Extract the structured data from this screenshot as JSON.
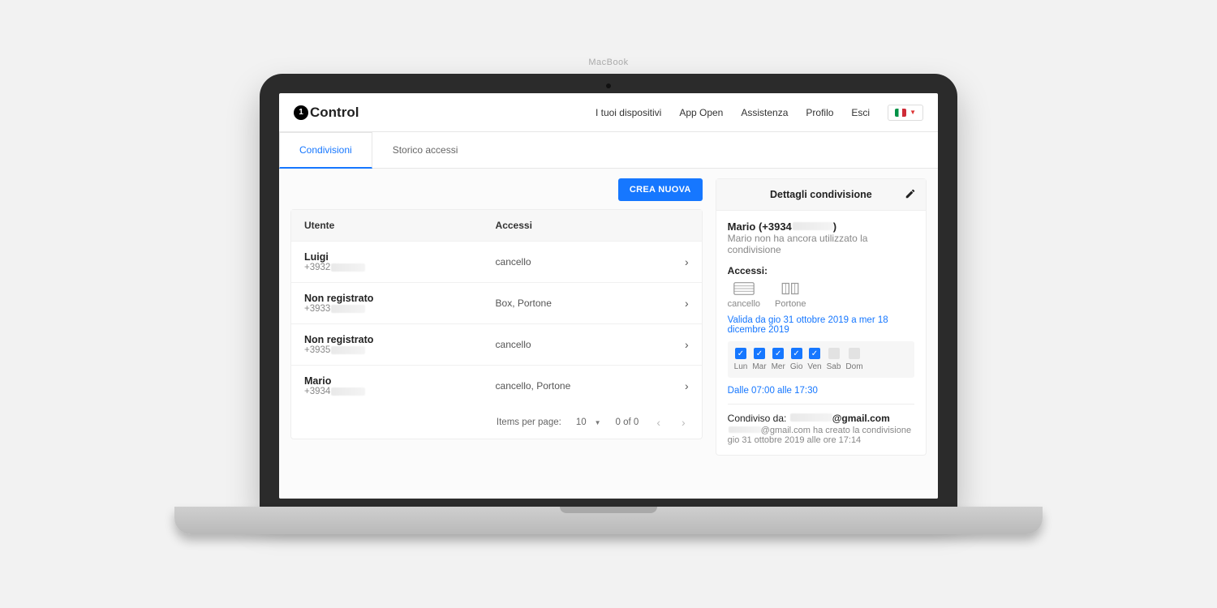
{
  "logo": {
    "mark": "1",
    "text": "Control"
  },
  "nav": {
    "devices": "I tuoi dispositivi",
    "appopen": "App Open",
    "support": "Assistenza",
    "profile": "Profilo",
    "logout": "Esci"
  },
  "tabs": {
    "shares": "Condivisioni",
    "history": "Storico accessi"
  },
  "buttons": {
    "create": "CREA NUOVA"
  },
  "table": {
    "col_user": "Utente",
    "col_access": "Accessi",
    "rows": [
      {
        "name": "Luigi",
        "phone_prefix": "+3932",
        "access": "cancello"
      },
      {
        "name": "Non registrato",
        "phone_prefix": "+3933",
        "access": "Box, Portone"
      },
      {
        "name": "Non registrato",
        "phone_prefix": "+3935",
        "access": "cancello"
      },
      {
        "name": "Mario",
        "phone_prefix": "+3934",
        "access": "cancello, Portone"
      }
    ]
  },
  "pager": {
    "label": "Items per page:",
    "size": "10",
    "range": "0 of 0"
  },
  "details": {
    "title": "Dettagli condivisione",
    "user_label": "Mario (+3934",
    "user_label_suffix": ")",
    "note": "Mario non ha ancora utilizzato la condivisione",
    "accessi_label": "Accessi:",
    "access_items": {
      "a": "cancello",
      "b": "Portone"
    },
    "validity": "Valida da gio 31 ottobre 2019 a mer 18 dicembre 2019",
    "days": {
      "lun": "Lun",
      "mar": "Mar",
      "mer": "Mer",
      "gio": "Gio",
      "ven": "Ven",
      "sab": "Sab",
      "dom": "Dom"
    },
    "days_on": {
      "lun": true,
      "mar": true,
      "mer": true,
      "gio": true,
      "ven": true,
      "sab": false,
      "dom": false
    },
    "hours": "Dalle 07:00 alle 17:30",
    "shared_by_label": "Condiviso da: ",
    "shared_by_email_suffix": "@gmail.com",
    "shared_meta_mid": "@gmail.com ha creato la condivisione gio 31 ottobre 2019 alle ore 17:14"
  },
  "macbook": "MacBook"
}
